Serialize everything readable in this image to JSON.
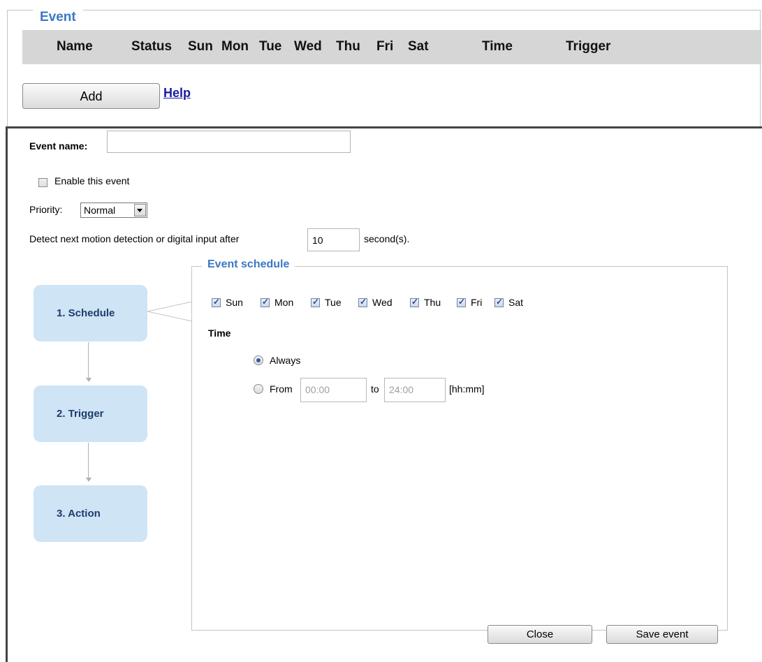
{
  "event_list": {
    "legend": "Event",
    "columns": [
      "Name",
      "Status",
      "Sun",
      "Mon",
      "Tue",
      "Wed",
      "Thu",
      "Fri",
      "Sat",
      "Time",
      "Trigger"
    ],
    "add_label": "Add",
    "help_label": "Help"
  },
  "editor": {
    "event_name_label": "Event name:",
    "event_name_value": "",
    "enable_label": "Enable this event",
    "enable_checked": false,
    "priority_label": "Priority:",
    "priority_value": "Normal",
    "detect_label": "Detect next motion detection or digital input after",
    "detect_value": "10",
    "detect_unit": "second(s).",
    "steps": [
      "1.  Schedule",
      "2.  Trigger",
      "3.  Action"
    ],
    "schedule": {
      "legend": "Event schedule",
      "days": [
        "Sun",
        "Mon",
        "Tue",
        "Wed",
        "Thu",
        "Fri",
        "Sat"
      ],
      "days_checked": [
        true,
        true,
        true,
        true,
        true,
        true,
        true
      ],
      "time_label": "Time",
      "always_label": "Always",
      "from_label": "From",
      "from_value": "00:00",
      "to_label": "to",
      "to_value": "24:00",
      "format_hint": "[hh:mm]",
      "selected_option": "Always"
    },
    "close_label": "Close",
    "save_label": "Save event"
  },
  "colors": {
    "legend_blue": "#3a78c3",
    "step_fill": "#cfe4f4",
    "header_gray": "#d6d6d6",
    "link_blue": "#1a1aa5"
  }
}
